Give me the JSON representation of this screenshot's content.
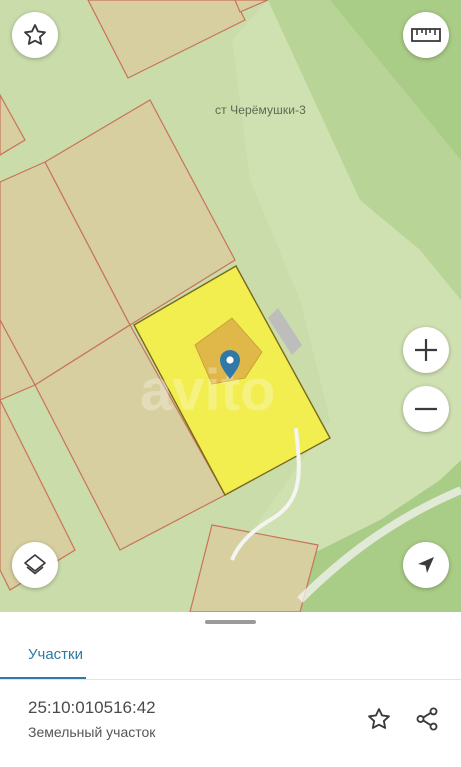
{
  "map": {
    "place_label": "ст Черёмушки-3",
    "watermark": "avito",
    "colors": {
      "background": "#c9dcaa",
      "parcel_fill": "#d7cfa0",
      "parcel_border": "#c9735a",
      "selected_parcel": "#f2ee50",
      "forest": "#a9cc86",
      "building": "#e0b84a",
      "pin": "#2f78a8"
    }
  },
  "controls": {
    "favorite_icon": "star-outline-icon",
    "ruler_icon": "ruler-icon",
    "zoom_in_icon": "plus-icon",
    "zoom_out_icon": "minus-icon",
    "layers_icon": "layers-icon",
    "locate_icon": "navigation-arrow-icon"
  },
  "sheet": {
    "tab_label": "Участки",
    "parcel_id": "25:10:010516:42",
    "parcel_type": "Земельный участок",
    "favorite_icon": "star-outline-icon",
    "share_icon": "share-icon"
  }
}
